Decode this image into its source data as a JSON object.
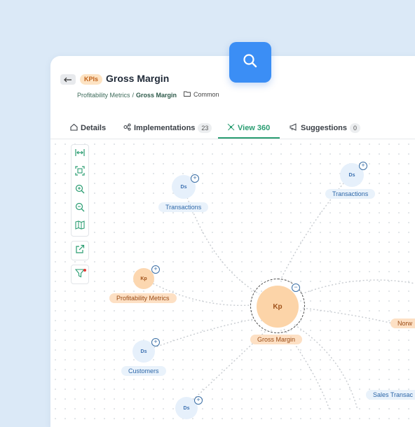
{
  "header": {
    "back_icon": "back-arrow-icon",
    "badge": "KPIs",
    "title": "Gross Margin",
    "breadcrumb_parent": "Profitability Metrics",
    "breadcrumb_sep": "/",
    "breadcrumb_current": "Gross Margin",
    "folder_label": "Common"
  },
  "tabs": [
    {
      "label": "Details",
      "icon": "home-icon"
    },
    {
      "label": "Implementations",
      "icon": "network-icon",
      "count": "23"
    },
    {
      "label": "View 360",
      "icon": "graph-icon",
      "active": true
    },
    {
      "label": "Suggestions",
      "icon": "megaphone-icon",
      "count": "0"
    }
  ],
  "toolbar": [
    "fit-width-icon",
    "fit-screen-icon",
    "zoom-in-icon",
    "zoom-out-icon",
    "map-icon",
    "share-icon",
    "filter-icon"
  ],
  "graph": {
    "center": {
      "abbr": "Kp",
      "label": "Gross Margin"
    },
    "nodes": [
      {
        "abbr": "Ds",
        "label": "Transactions",
        "kind": "ds"
      },
      {
        "abbr": "Ds",
        "label": "Transactions",
        "kind": "ds"
      },
      {
        "abbr": "Kp",
        "label": "Profitability Metrics",
        "kind": "kp"
      },
      {
        "abbr": "Ds",
        "label": "Customers",
        "kind": "ds"
      },
      {
        "abbr": "Ds",
        "label": "",
        "kind": "ds"
      },
      {
        "abbr": "",
        "label": "Norw",
        "kind": "kp"
      },
      {
        "abbr": "",
        "label": "Sales Transac",
        "kind": "ds"
      }
    ]
  },
  "colors": {
    "accent": "#2a9d72",
    "search_button": "#3b8ef5",
    "kpi": "#fcd4a8",
    "dataset": "#e6f0fb"
  }
}
